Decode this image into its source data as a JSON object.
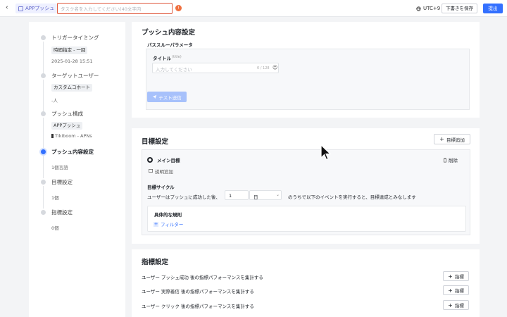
{
  "header": {
    "back_icon": "chevron-left-icon",
    "app_tag": "APPプッシュ",
    "task_name_placeholder": "タスク名を入力してください(40文字内",
    "error_icon": "alert-icon",
    "timezone": "UTC+9",
    "draft_button": "下書きを保存",
    "submit_button": "提出"
  },
  "sidebar": {
    "steps": [
      {
        "title": "トリガータイミング",
        "chip": "時間指定 - 一回",
        "sub": "2025-01-28 15:51"
      },
      {
        "title": "ターゲットユーザー",
        "chip": "カスタムコホート",
        "sub": "-人"
      },
      {
        "title": "プッシュ構成",
        "chip": "APPプッシュ",
        "sub": "Tikiboom - APNs"
      },
      {
        "title": "プッシュ内容設定",
        "sub": "1個言語"
      },
      {
        "title": "目標設定",
        "sub": "1個"
      },
      {
        "title": "指標設定",
        "sub": "0個"
      }
    ]
  },
  "content": {
    "title": "プッシュ内容設定",
    "passthrough_label": "パススルーパラメータ",
    "field_title_label": "タイトル",
    "field_title_hint": "(title)",
    "field_title_placeholder": "入力してください",
    "field_title_counter": "0 / 128",
    "test_send_button": "テスト送信"
  },
  "goals": {
    "title": "目標設定",
    "add_button": "目標追加",
    "main_goal_label": "メイン目標",
    "delete_label": "削除",
    "add_desc": "説明追加",
    "cycle_label": "目標サイクル",
    "cycle_prefix": "ユーザーはプッシュに成功した後、",
    "cycle_value": "1",
    "cycle_unit": "日",
    "cycle_suffix": "のうちで以下のイベントを実行すると、目標達成とみなします",
    "rules_label": "具体的な規則",
    "filter_button": "フィルター"
  },
  "metrics": {
    "title": "指標設定",
    "rows": [
      {
        "text": "ユーザー  プッシュ成功  後の指標パフォーマンスを集計する",
        "button": "指標"
      },
      {
        "text": "ユーザー  実際着信  後の指標パフォーマンスを集計する",
        "button": "指標"
      },
      {
        "text": "ユーザー  クリック  後の指標パフォーマンスを集計する",
        "button": "指標"
      }
    ]
  }
}
